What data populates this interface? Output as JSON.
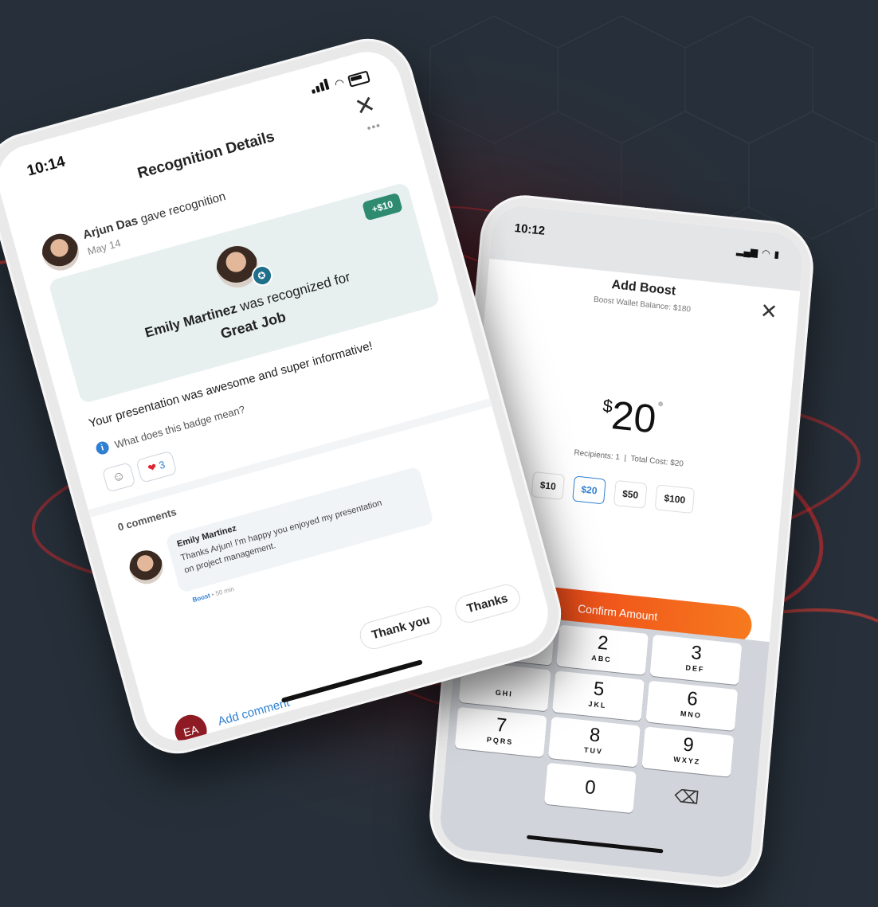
{
  "phone1": {
    "status_time": "10:14",
    "title": "Recognition Details",
    "more_icon": "more-dots-icon",
    "giver": {
      "name": "Arjun Das",
      "action": "gave recognition",
      "date": "May 14"
    },
    "points_badge": "+$10",
    "recipient_line": {
      "name": "Emily Martinez",
      "text": "was recognized for"
    },
    "award": "Great Job",
    "message": "Your presentation was awesome and super informative!",
    "badge_help": "What does this badge mean?",
    "reaction_count": "3",
    "comments_count": "0 comments",
    "comment": {
      "author": "Emily Martinez",
      "text_line1": "Thanks Arjun! I'm happy you enjoyed my presentation",
      "text_line2": "on project management.",
      "meta_action": "Boost",
      "meta_time": "• 50 min"
    },
    "quick_replies": [
      "Thank you",
      "Thanks"
    ],
    "user_initials": "EA",
    "add_comment": "Add comment"
  },
  "phone2": {
    "status_time": "10:12",
    "title": "Add Boost",
    "subtitle": "Boost Wallet Balance: $180",
    "currency": "$",
    "amount": "20",
    "recipients": "Recipients: 1",
    "separator": "|",
    "total_cost": "Total Cost: $20",
    "amount_options": [
      "$10",
      "$20",
      "$50",
      "$100"
    ],
    "selected_option": "$20",
    "confirm": "Confirm Amount",
    "keys": [
      {
        "n": "2",
        "l": "ABC"
      },
      {
        "n": "3",
        "l": "DEF"
      },
      {
        "n": "5",
        "l": "JKL"
      },
      {
        "n": "6",
        "l": "MNO"
      },
      {
        "n": "7",
        "l": "PQRS"
      },
      {
        "n": "8",
        "l": "TUV"
      },
      {
        "n": "9",
        "l": "WXYZ"
      },
      {
        "n": "0",
        "l": ""
      }
    ],
    "partial_key_label": "GHI"
  },
  "colors": {
    "accent_green": "#2e8b6f",
    "accent_blue": "#2f80d1",
    "orange_start": "#ea3a18",
    "orange_end": "#f77a1e",
    "avatar_red": "#8e1b24"
  }
}
